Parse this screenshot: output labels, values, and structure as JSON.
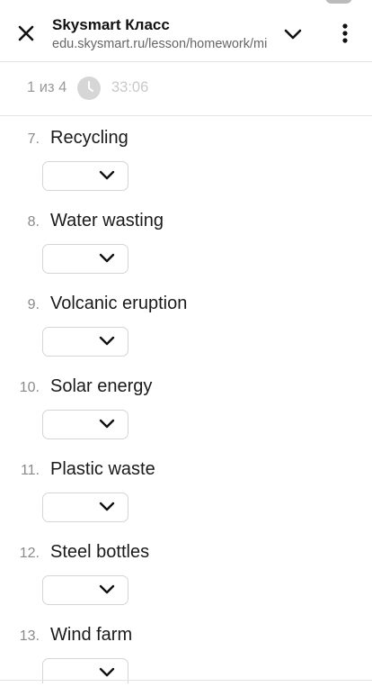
{
  "header": {
    "app_title": "Skysmart Класс",
    "url": "edu.skysmart.ru/lesson/homework/mi"
  },
  "progress": {
    "page_counter": "1 из 4",
    "timer": "33:06"
  },
  "questions": [
    {
      "number": "7.",
      "label": "Recycling"
    },
    {
      "number": "8.",
      "label": "Water wasting"
    },
    {
      "number": "9.",
      "label": "Volcanic eruption"
    },
    {
      "number": "10.",
      "label": "Solar energy"
    },
    {
      "number": "11.",
      "label": "Plastic waste"
    },
    {
      "number": "12.",
      "label": "Steel bottles"
    },
    {
      "number": "13.",
      "label": "Wind farm"
    }
  ],
  "icons": {
    "close": "close-icon",
    "expand": "chevron-down-icon",
    "more": "more-vertical-icon",
    "timer": "clock-icon",
    "select": "chevron-down-icon"
  },
  "colors": {
    "text": "#111111",
    "muted": "#9a9a9a",
    "timer": "#c9c9c9",
    "border": "#d5d5d5",
    "divider": "#e3e3e3"
  }
}
